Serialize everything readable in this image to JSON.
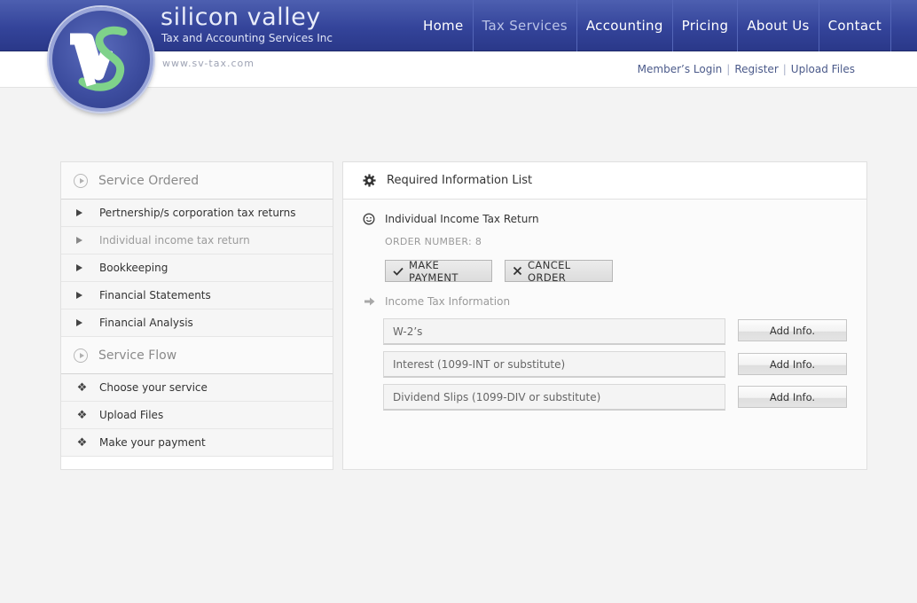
{
  "brand": {
    "name": "silicon valley",
    "tagline": "Tax and Accounting Services Inc",
    "url": "www.sv-tax.com"
  },
  "nav": {
    "items": [
      {
        "label": "Home"
      },
      {
        "label": "Tax Services"
      },
      {
        "label": "Accounting"
      },
      {
        "label": "Pricing"
      },
      {
        "label": "About Us"
      },
      {
        "label": "Contact"
      }
    ],
    "active": "Tax Services"
  },
  "member_links": {
    "login": "Member’s Login",
    "register": "Register",
    "upload": "Upload Files"
  },
  "sidebar": {
    "service_ordered_title": "Service Ordered",
    "services": [
      {
        "label": "Pertnership/s corporation tax returns"
      },
      {
        "label": "Individual income tax return"
      },
      {
        "label": "Bookkeeping"
      },
      {
        "label": "Financial Statements"
      },
      {
        "label": "Financial Analysis"
      }
    ],
    "service_flow_title": "Service Flow",
    "flow": [
      {
        "label": "Choose your service"
      },
      {
        "label": "Upload Files"
      },
      {
        "label": "Make your payment"
      }
    ]
  },
  "main": {
    "title": "Required Information List",
    "return_title": "Individual Income Tax Return",
    "order_number": "ORDER NUMBER: 8",
    "make_payment": "MAKE PAYMENT",
    "cancel_order": "CANCEL ORDER",
    "section_title": "Income Tax Information",
    "rows": [
      {
        "label": "W-2’s",
        "button": "Add Info."
      },
      {
        "label": "Interest (1099-INT or substitute)",
        "button": "Add Info."
      },
      {
        "label": "Dividend Slips (1099-DIV or substitute)",
        "button": "Add Info."
      }
    ]
  },
  "colors": {
    "header_blue": "#34449a",
    "background": "#f3f3f3",
    "logo_green": "#7fd28a"
  }
}
